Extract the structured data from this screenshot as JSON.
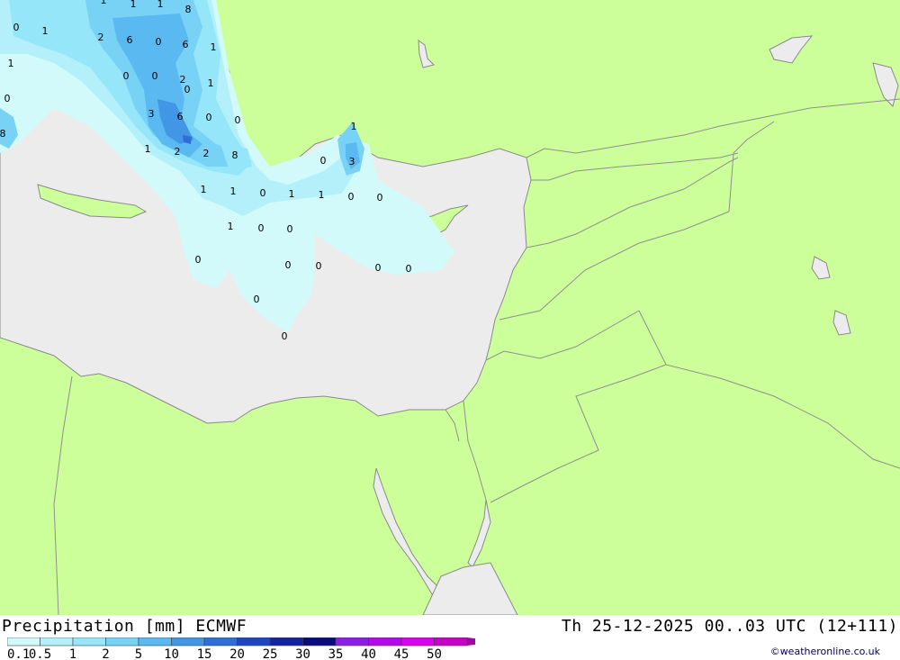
{
  "map": {
    "colors": {
      "land": "#ccff99",
      "sea": "#ececec",
      "border": "#909090",
      "coast": "#8a8a8a",
      "labelText": "#000000"
    },
    "precip_labels": [
      "0",
      "1",
      "1",
      "8",
      "1",
      "1",
      "2",
      "6",
      "0",
      "6",
      "1",
      "1",
      "0",
      "0",
      "2",
      "1",
      "0",
      "0",
      "3",
      "6",
      "0",
      "0",
      "8",
      "1",
      "2",
      "2",
      "8",
      "1",
      "0",
      "3",
      "1",
      "1",
      "0",
      "1",
      "1",
      "0",
      "0",
      "1",
      "0",
      "0",
      "0",
      "0",
      "0",
      "0",
      "0",
      "0",
      "0"
    ]
  },
  "footer": {
    "title": "Precipitation [mm] ECMWF",
    "datetime": "Th 25-12-2025 00..03 UTC (12+111)",
    "copyright": "©weatheronline.co.uk",
    "legend": {
      "labels": [
        "0.1",
        "0.5",
        "1",
        "2",
        "5",
        "10",
        "15",
        "20",
        "25",
        "30",
        "35",
        "40",
        "45",
        "50"
      ],
      "colors": [
        "#d2fafa",
        "#b4f0fa",
        "#96e6fa",
        "#78d2f5",
        "#5ab9f0",
        "#4196e6",
        "#2d6ed7",
        "#1e46c3",
        "#1423a5",
        "#0a0a82",
        "#8c1ee6",
        "#b40aeb",
        "#dc00f0",
        "#c800c8",
        "#aa00aa"
      ]
    }
  }
}
